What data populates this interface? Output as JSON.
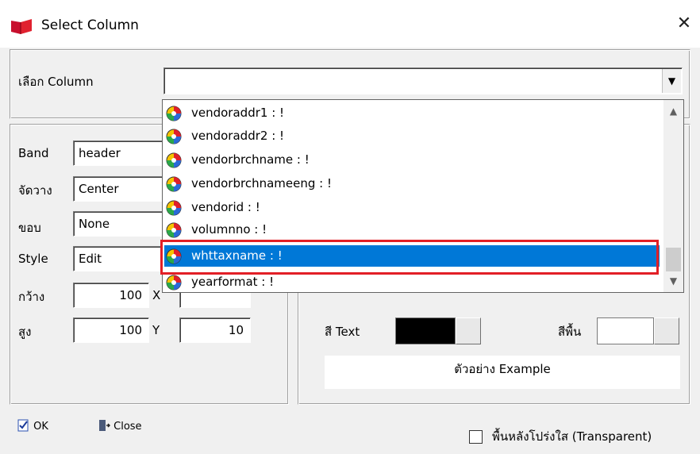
{
  "window": {
    "title": "Select Column",
    "close_symbol": "✕"
  },
  "column_select": {
    "label": "เลือก Column",
    "value": "",
    "dropdown_arrow": "▼"
  },
  "dropdown": {
    "items": [
      {
        "label": "vendoraddr1 : !"
      },
      {
        "label": "vendoraddr2 : !"
      },
      {
        "label": "vendorbrchname : !"
      },
      {
        "label": "vendorbrchnameeng : !"
      },
      {
        "label": "vendorid : !"
      },
      {
        "label": "volumnno : !"
      },
      {
        "label": "whttaxname : !"
      },
      {
        "label": "yearformat : !"
      }
    ],
    "selected_index": 6,
    "scroll_up": "▲",
    "scroll_down": "▼"
  },
  "properties": {
    "band": {
      "label": "Band",
      "value": "header"
    },
    "align": {
      "label": "จัดวาง",
      "value": "Center"
    },
    "border": {
      "label": "ขอบ",
      "value": "None"
    },
    "style": {
      "label": "Style",
      "value": "Edit"
    },
    "width": {
      "label": "กว้าง",
      "value": "100"
    },
    "height": {
      "label": "สูง",
      "value": "100"
    },
    "x": {
      "label": "X",
      "value": ""
    },
    "y": {
      "label": "Y",
      "value": "10"
    }
  },
  "colors": {
    "text_color": {
      "label": "สี Text",
      "value": "#000000"
    },
    "background_color": {
      "label": "สีพื้น",
      "value": "#ffffff"
    }
  },
  "example": {
    "text": "ตัวอย่าง Example"
  },
  "buttons": {
    "ok": "OK",
    "close": "Close"
  },
  "transparent": {
    "label": "พื้นหลังโปร่งใส (Transparent)",
    "checked": false
  },
  "accent": {
    "selection": "#0078d7",
    "highlight_box": "#e21f26"
  }
}
